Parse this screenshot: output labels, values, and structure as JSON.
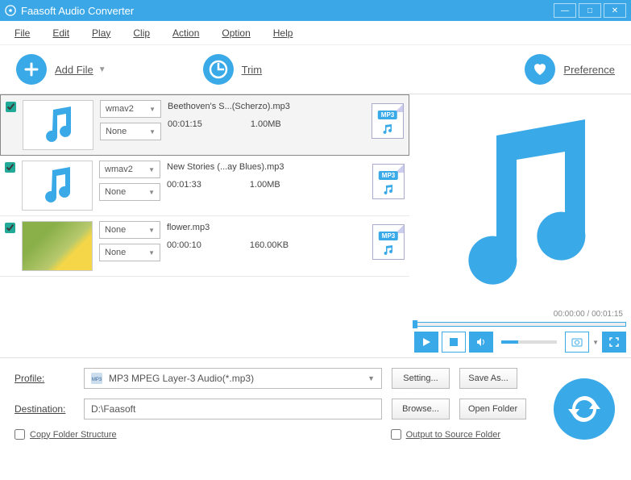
{
  "window": {
    "title": "Faasoft Audio Converter"
  },
  "menu": {
    "file": "File",
    "edit": "Edit",
    "play": "Play",
    "clip": "Clip",
    "action": "Action",
    "option": "Option",
    "help": "Help"
  },
  "toolbar": {
    "add_file": "Add File",
    "trim": "Trim",
    "preference": "Preference"
  },
  "files": [
    {
      "codec": "wmav2",
      "effect": "None",
      "name": "Beethoven's S...(Scherzo).mp3",
      "duration": "00:01:15",
      "size": "1.00MB",
      "badge": "MP3",
      "thumb": "music",
      "checked": true,
      "selected": true
    },
    {
      "codec": "wmav2",
      "effect": "None",
      "name": "New Stories (...ay Blues).mp3",
      "duration": "00:01:33",
      "size": "1.00MB",
      "badge": "MP3",
      "thumb": "music",
      "checked": true,
      "selected": false
    },
    {
      "codec": "None",
      "effect": "None",
      "name": "flower.mp3",
      "duration": "00:00:10",
      "size": "160.00KB",
      "badge": "MP3",
      "thumb": "flower",
      "checked": true,
      "selected": false
    }
  ],
  "preview": {
    "current_time": "00:00:00",
    "total_time": "00:01:15"
  },
  "profile": {
    "label": "Profile:",
    "value": "MP3 MPEG Layer-3 Audio(*.mp3)",
    "setting_btn": "Setting...",
    "saveas_btn": "Save As..."
  },
  "destination": {
    "label": "Destination:",
    "value": "D:\\Faasoft",
    "browse_btn": "Browse...",
    "open_btn": "Open Folder"
  },
  "options": {
    "copy_structure": "Copy Folder Structure",
    "output_source": "Output to Source Folder"
  }
}
